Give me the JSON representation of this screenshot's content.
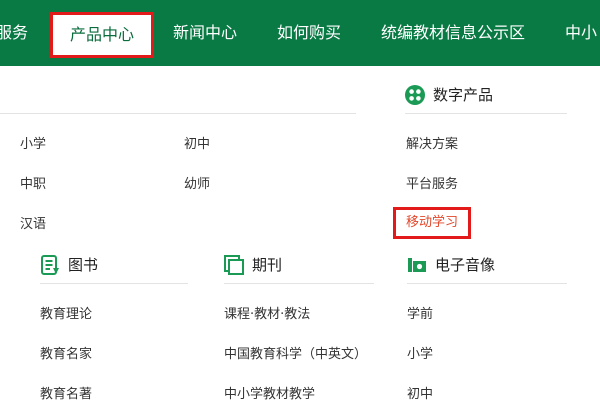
{
  "nav": {
    "items": [
      "服务",
      "产品中心",
      "新闻中心",
      "如何购买",
      "统编教材信息公示区",
      "中小"
    ],
    "active_index": 1
  },
  "menu": {
    "top_left": {
      "col1": [
        "小学",
        "中职",
        "汉语"
      ],
      "col2": [
        "初中",
        "幼师"
      ]
    },
    "digital": {
      "title": "数字产品",
      "icon": "grid-icon",
      "items": [
        "解决方案",
        "平台服务",
        "移动学习"
      ],
      "highlight_index": 2
    },
    "books": {
      "title": "图书",
      "icon": "book-icon",
      "items": [
        "教育理论",
        "教育名家",
        "教育名著"
      ]
    },
    "journals": {
      "title": "期刊",
      "icon": "journal-icon",
      "items": [
        "课程·教材·教法",
        "中国教育科学（中英文）",
        "中小学教材教学"
      ]
    },
    "av": {
      "title": "电子音像",
      "icon": "media-icon",
      "items": [
        "学前",
        "小学",
        "初中"
      ]
    }
  },
  "colors": {
    "nav_bg": "#0a7a45",
    "accent_green": "#1a9a55",
    "highlight_red": "#e21a1a",
    "active_link": "#e2472a"
  }
}
